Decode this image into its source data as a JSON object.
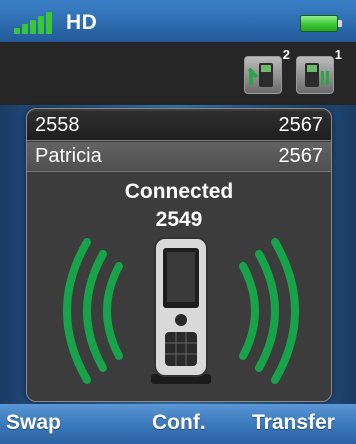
{
  "status_bar": {
    "network_label": "HD",
    "signal_icon": "signal-bars-icon",
    "battery_icon": "battery-icon",
    "signal_color": "#39c637",
    "battery_color": "#36c431"
  },
  "toolbar": {
    "incoming_calls": {
      "icon": "incoming-call-icon",
      "count": "2"
    },
    "held_calls": {
      "icon": "held-call-icon",
      "count": "1"
    }
  },
  "calls": [
    {
      "name": "2558",
      "number": "2567"
    },
    {
      "name": "Patricia",
      "number": "2567"
    }
  ],
  "call_status": {
    "state": "Connected",
    "number": "2549"
  },
  "softkeys": {
    "left": "Swap",
    "middle": "Conf.",
    "right": "Transfer"
  },
  "colors": {
    "accent_blue": "#3b80c6",
    "wave_green": "#17a34a"
  }
}
